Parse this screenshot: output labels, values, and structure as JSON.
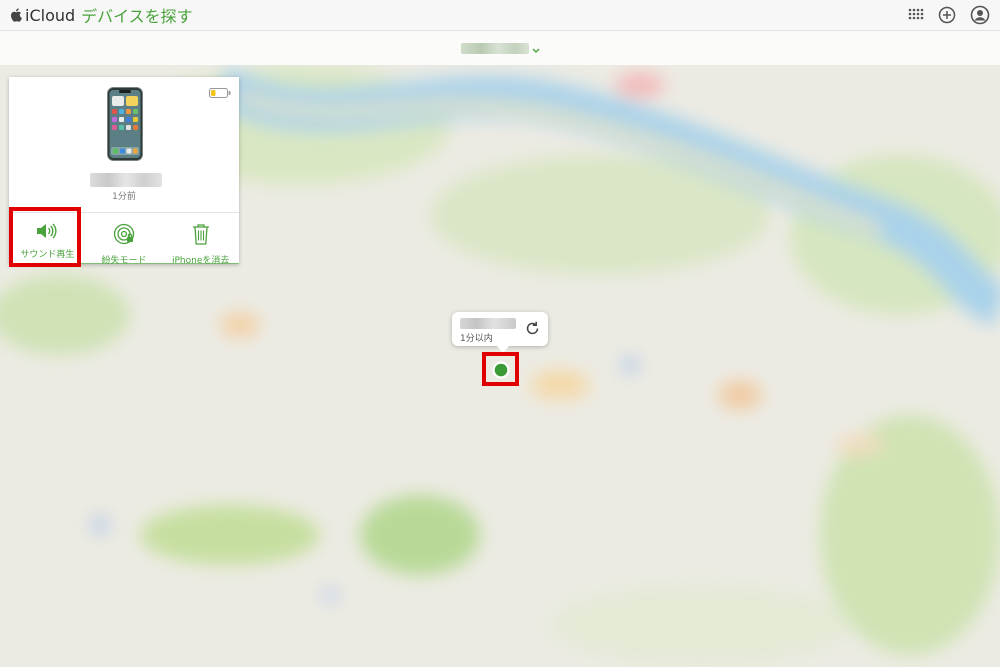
{
  "header": {
    "brand": "iCloud",
    "app_title": "デバイスを探す",
    "icons": [
      "apple-logo-icon",
      "app-grid-icon",
      "add-icon",
      "account-icon"
    ]
  },
  "device_panel": {
    "last_seen": "1分前",
    "battery_level": 0.25,
    "actions": [
      {
        "label": "サウンド再生",
        "icon": "speaker-icon"
      },
      {
        "label": "紛失モード",
        "icon": "lost-mode-icon"
      },
      {
        "label": "iPhoneを消去",
        "icon": "trash-icon"
      }
    ]
  },
  "map_popup": {
    "time": "1分以内",
    "icon": "refresh-icon"
  },
  "colors": {
    "accent": "#4aa23c",
    "highlight": "#e10000",
    "location_dot": "#3a9a33"
  }
}
